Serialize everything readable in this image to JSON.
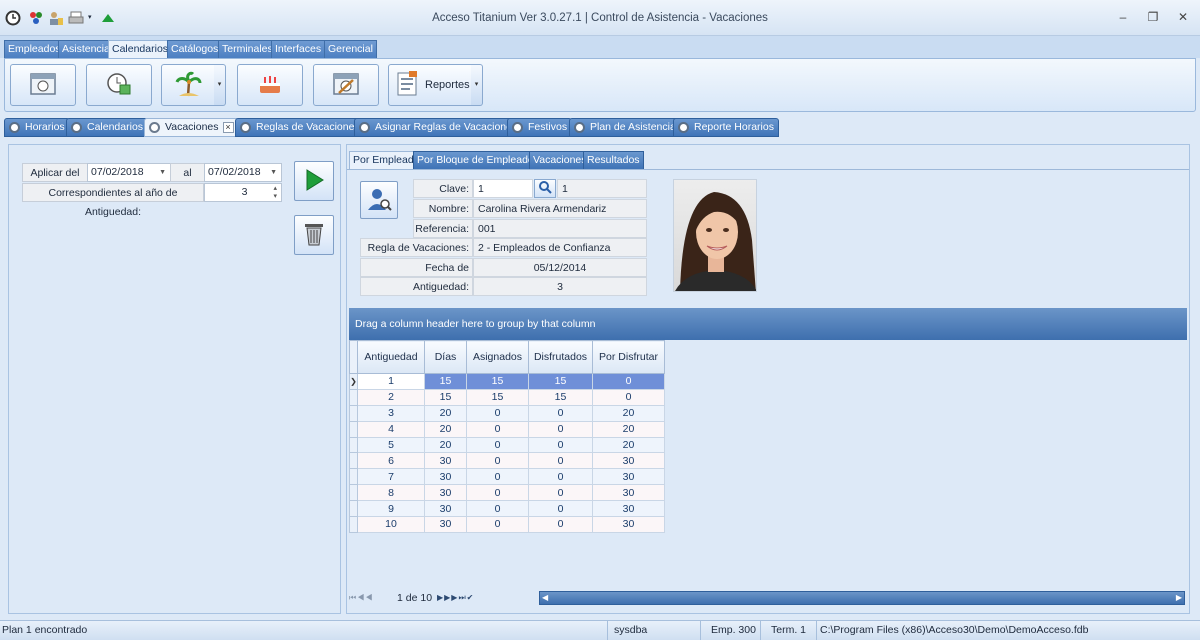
{
  "window": {
    "title": "Acceso Titanium  Ver 3.0.27.1 | Control de Asistencia - Vacaciones",
    "minimize": "–",
    "maximize": "❐",
    "close": "✕"
  },
  "ribbon_tabs": [
    "Empleados",
    "Asistencia",
    "Calendarios",
    "Catálogos",
    "Terminales",
    "Interfaces",
    "Gerencial"
  ],
  "ribbon": {
    "buttons": [
      "calendar-icon",
      "clock-calendar-icon",
      "palm-tree-icon",
      "cake-icon",
      "calendar-edit-icon"
    ],
    "reportes_label": "Reportes"
  },
  "doc_tabs": [
    "Horarios",
    "Calendarios",
    "Vacaciones",
    "Reglas de Vacaciones",
    "Asignar Reglas de Vacaciones",
    "Festivos",
    "Plan de Asistencia",
    "Reporte Horarios"
  ],
  "left": {
    "aplicar_label": "Aplicar del",
    "date_from": "07/02/2018",
    "al_label": "al",
    "date_to": "07/02/2018",
    "antiguedad_label": "Correspondientes al año de Antiguedad:",
    "antiguedad_value": "3"
  },
  "sub_tabs": [
    "Por Empleado",
    "Por Bloque de Empleados",
    "Vacaciones",
    "Resultados"
  ],
  "employee": {
    "clave_label": "Clave:",
    "clave_value": "1",
    "clave_extra": "1",
    "nombre_label": "Nombre:",
    "nombre_value": "Carolina Rivera Armendariz",
    "referencia_label": "Referencia:",
    "referencia_value": "001",
    "regla_label": "Regla de Vacaciones:",
    "regla_value": "2 - Empleados de Confianza",
    "fecha_label": "Fecha de Contratación:",
    "fecha_value": "05/12/2014",
    "antiguedad_label": "Antiguedad:",
    "antiguedad_value": "3"
  },
  "grid": {
    "group_hint": "Drag a column header here to group by that column",
    "columns": [
      "Antiguedad",
      "Días",
      "Asignados",
      "Disfrutados",
      "Por Disfrutar"
    ],
    "rows": [
      [
        "1",
        "15",
        "15",
        "15",
        "0"
      ],
      [
        "2",
        "15",
        "15",
        "15",
        "0"
      ],
      [
        "3",
        "20",
        "0",
        "0",
        "20"
      ],
      [
        "4",
        "20",
        "0",
        "0",
        "20"
      ],
      [
        "5",
        "20",
        "0",
        "0",
        "20"
      ],
      [
        "6",
        "30",
        "0",
        "0",
        "30"
      ],
      [
        "7",
        "30",
        "0",
        "0",
        "30"
      ],
      [
        "8",
        "30",
        "0",
        "0",
        "30"
      ],
      [
        "9",
        "30",
        "0",
        "0",
        "30"
      ],
      [
        "10",
        "30",
        "0",
        "0",
        "30"
      ]
    ],
    "selected_row": 0,
    "pager": "1 de 10"
  },
  "status": {
    "message": "Plan 1 encontrado",
    "user": "sysdba",
    "emp": "Emp. 300",
    "term": "Term. 1",
    "path": "C:\\Program Files (x86)\\Acceso30\\Demo\\DemoAcceso.fdb"
  },
  "colors": {
    "accent": "#3f74b8",
    "selected_row": "#6f8fd8",
    "run_button": "#1f9e3a"
  }
}
